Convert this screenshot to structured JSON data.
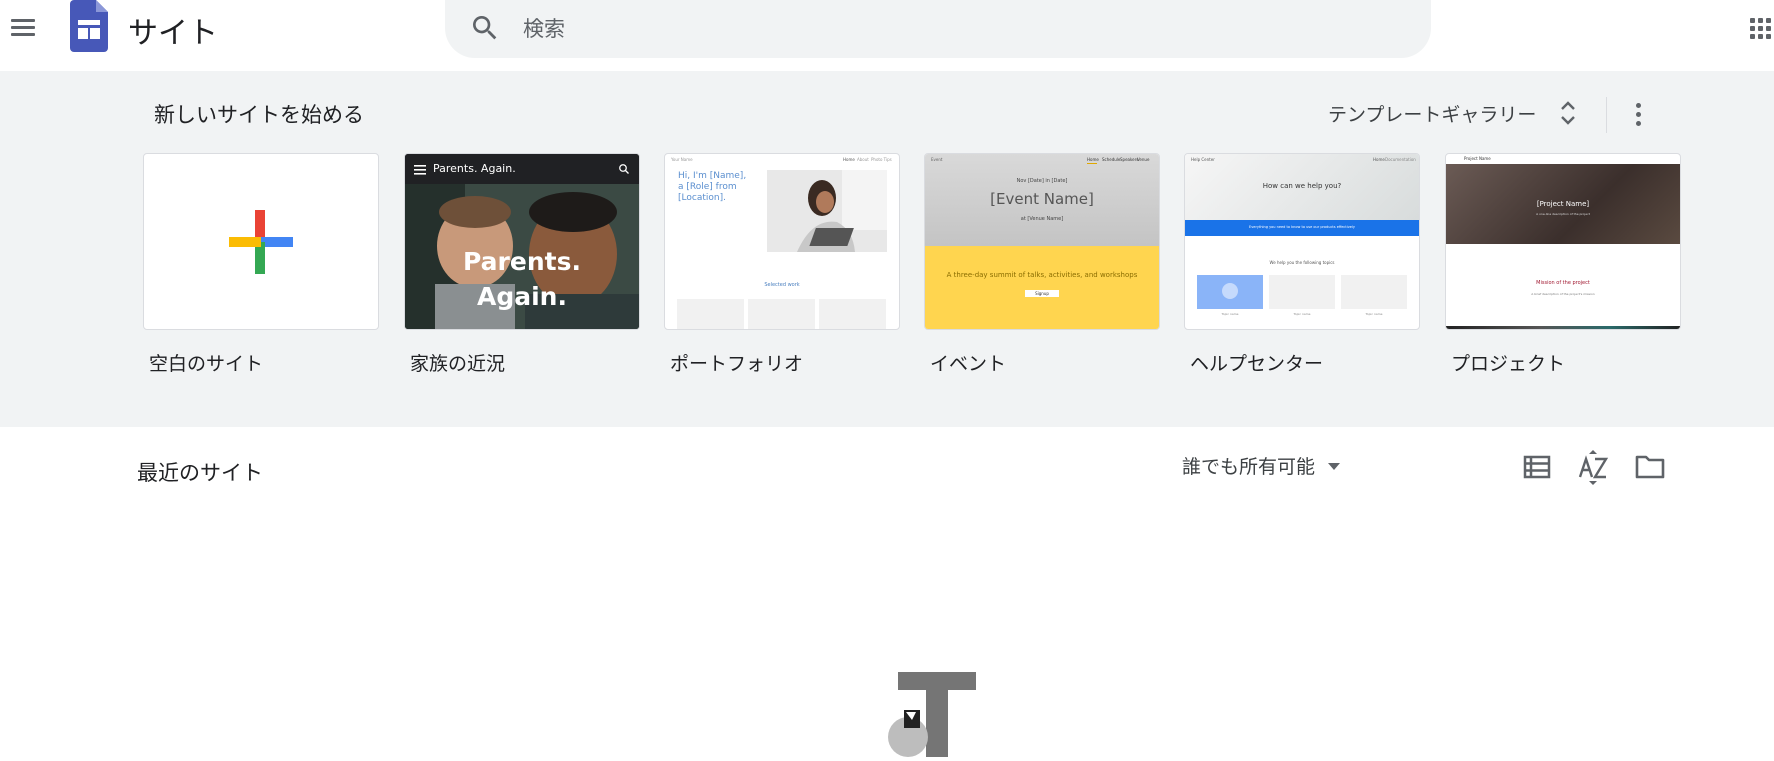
{
  "header": {
    "app_title": "サイト",
    "search": {
      "placeholder": "検索"
    }
  },
  "templates": {
    "heading": "新しいサイトを始める",
    "gallery_label": "テンプレートギャラリー",
    "items": [
      {
        "label": "空白のサイト"
      },
      {
        "label": "家族の近況",
        "thumb": {
          "nav_title": "Parents. Again.",
          "hero_line1": "Parents.",
          "hero_line2": "Again."
        }
      },
      {
        "label": "ポートフォリオ",
        "thumb": {
          "site_name": "Your Name",
          "nav": [
            "Home",
            "About",
            "Photo Tips"
          ],
          "intro": "Hi, I'm [Name], a [Role] from [Location].",
          "section": "Selected work"
        }
      },
      {
        "label": "イベント",
        "thumb": {
          "logo": "Event",
          "nav": [
            "Home",
            "Schedule",
            "Speakers",
            "Venue"
          ],
          "date_line": "Nov [Date] in [Date]",
          "event_name": "[Event Name]",
          "venue": "at [Venue Name]",
          "tagline": "A three-day summit of talks, activities, and workshops",
          "button": "Signup"
        }
      },
      {
        "label": "ヘルプセンター",
        "thumb": {
          "site_name": "Help Center",
          "nav": [
            "Home",
            "Documentation"
          ],
          "question": "How can we help you?",
          "banner": "Everything you need to know to use our products effectively",
          "subheading": "We help you the following topics",
          "topics": [
            "Topic name",
            "Topic name",
            "Topic name"
          ]
        }
      },
      {
        "label": "プロジェクト",
        "thumb": {
          "site_name": "Project Name",
          "title": "[Project Name]",
          "subtitle": "A one-line description of the project",
          "mission": "Mission of the project",
          "mission_text": "A brief description of the project's mission"
        }
      }
    ]
  },
  "recent": {
    "title": "最近のサイト",
    "owner_filter": "誰でも所有可能"
  },
  "icons": {
    "menu": "hamburger-menu-icon",
    "logo": "google-sites-logo",
    "search": "search-icon",
    "apps": "apps-grid-icon",
    "gallery_toggle": "unfold-more-icon",
    "more": "more-vert-icon",
    "add": "plus-icon",
    "list_view": "list-view-icon",
    "sort": "sort-az-icon",
    "folder": "folder-icon"
  },
  "colors": {
    "brand_blue": "#4758b8",
    "section_bg": "#f1f3f4",
    "plus_red": "#ea4335",
    "plus_blue": "#4285f4",
    "plus_green": "#34a853",
    "plus_yellow": "#fbbc04",
    "event_yellow": "#ffd54f",
    "help_blue": "#1a73e8"
  }
}
